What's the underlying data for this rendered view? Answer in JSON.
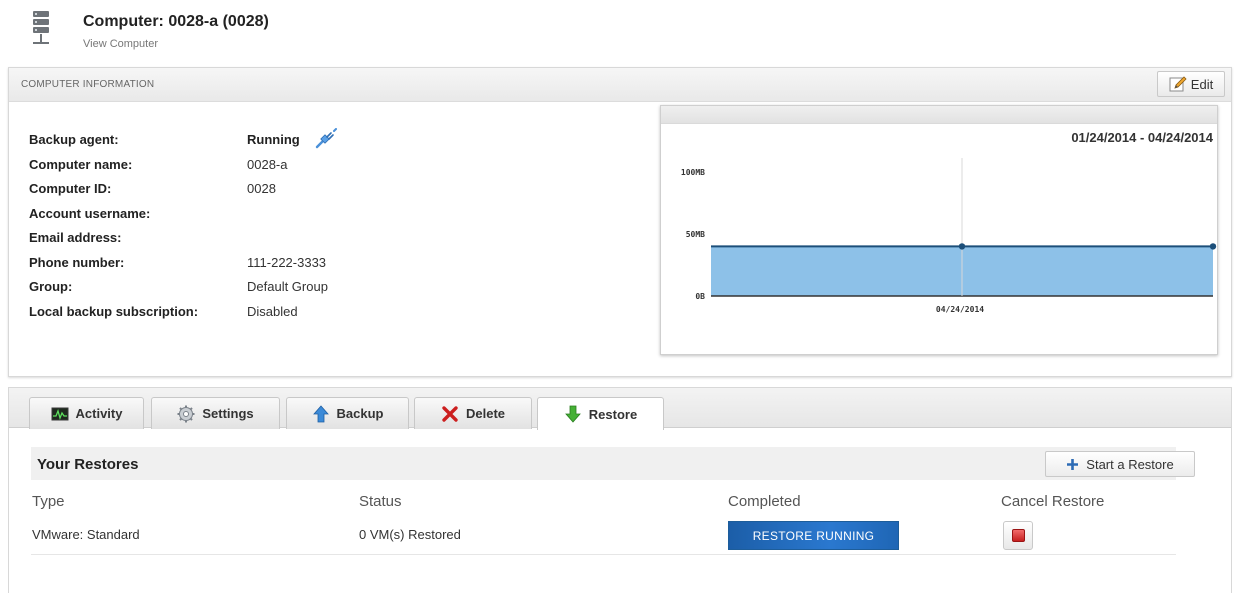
{
  "header": {
    "title": "Computer: 0028-a (0028)",
    "subtitle": "View Computer"
  },
  "info_panel": {
    "title": "COMPUTER INFORMATION",
    "edit_label": "Edit",
    "rows": [
      {
        "label": "Backup agent:",
        "value": "Running"
      },
      {
        "label": "Computer name:",
        "value": "0028-a"
      },
      {
        "label": "Computer ID:",
        "value": "0028"
      },
      {
        "label": "Account username:",
        "value": ""
      },
      {
        "label": "Email address:",
        "value": ""
      },
      {
        "label": "Phone number:",
        "value": "111-222-3333"
      },
      {
        "label": "Group:",
        "value": "Default Group"
      },
      {
        "label": "Local backup subscription:",
        "value": "Disabled"
      }
    ]
  },
  "chart_data": {
    "type": "area",
    "title": "01/24/2014 - 04/24/2014",
    "x": [
      "01/24/2014",
      "04/24/2014"
    ],
    "x_tick_labels": [
      "04/24/2014"
    ],
    "series": [
      {
        "values": [
          40,
          40
        ]
      }
    ],
    "y_tick_labels": [
      "0B",
      "50MB",
      "100MB"
    ],
    "y_ticks": [
      0,
      50,
      100
    ],
    "ylim": [
      0,
      100
    ],
    "unit": "MB",
    "grid": false,
    "legend": "none",
    "fill_color": "#8dc1e8",
    "line_color": "#1c4f7a"
  },
  "tabs": [
    {
      "label": "Activity",
      "icon": "activity-monitor-icon"
    },
    {
      "label": "Settings",
      "icon": "gear-icon"
    },
    {
      "label": "Backup",
      "icon": "up-arrow-icon"
    },
    {
      "label": "Delete",
      "icon": "red-x-icon"
    },
    {
      "label": "Restore",
      "icon": "down-arrow-icon",
      "active": true
    }
  ],
  "restores": {
    "title": "Your Restores",
    "start_label": "Start a Restore",
    "columns": [
      "Type",
      "Status",
      "Completed",
      "Cancel Restore"
    ],
    "rows": [
      {
        "type": "VMware: Standard",
        "status": "0 VM(s) Restored",
        "completed": "RESTORE RUNNING"
      }
    ]
  },
  "colors": {
    "status_blue": "#1f66b5",
    "stop_red": "#c61f1f",
    "delete_red": "#cc1f1f",
    "restore_green": "#3aa22e",
    "backup_blue": "#2e7fd3"
  }
}
